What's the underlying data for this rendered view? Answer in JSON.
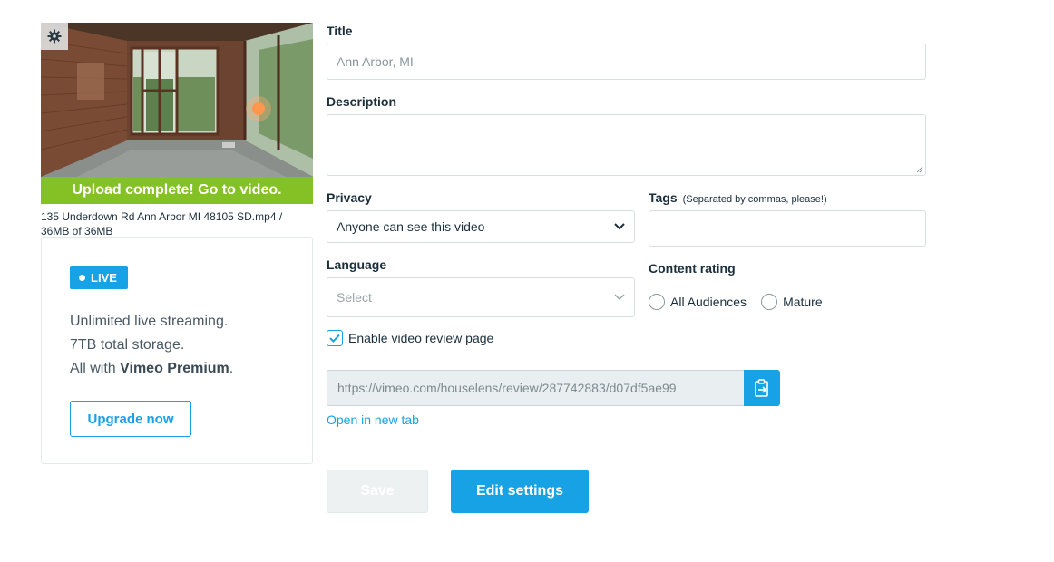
{
  "video": {
    "thumbnail_alt": "video-thumbnail",
    "banner": "Upload complete! Go to video.",
    "file_name": "135 Underdown Rd Ann Arbor MI 48105 SD.mp4 /",
    "file_progress": "36MB of 36MB"
  },
  "promo": {
    "badge": "LIVE",
    "line1": "Unlimited live streaming.",
    "line2": "7TB total storage.",
    "line3_prefix": "All with ",
    "line3_bold": "Vimeo Premium",
    "line3_suffix": ".",
    "upgrade_label": "Upgrade now"
  },
  "form": {
    "title_label": "Title",
    "title_value": "Ann Arbor, MI",
    "description_label": "Description",
    "description_value": "",
    "privacy_label": "Privacy",
    "privacy_value": "Anyone can see this video",
    "tags_label": "Tags",
    "tags_hint": "(Separated by commas, please!)",
    "tags_value": "",
    "language_label": "Language",
    "language_placeholder": "Select",
    "content_rating_label": "Content rating",
    "rating_options": [
      "All Audiences",
      "Mature"
    ],
    "review_checkbox_label": "Enable video review page",
    "review_checked": true,
    "review_url": "https://vimeo.com/houselens/review/287742883/d07df5ae99",
    "open_link": "Open in new tab"
  },
  "actions": {
    "save_label": "Save",
    "edit_label": "Edit settings"
  },
  "colors": {
    "accent": "#17a2e6",
    "success": "#84c125",
    "text": "#1a2e3b"
  }
}
